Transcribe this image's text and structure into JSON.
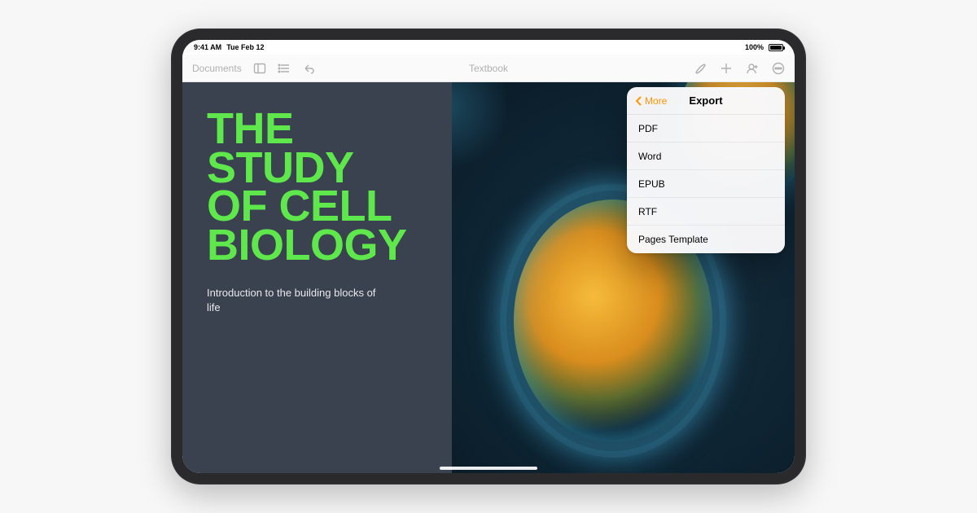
{
  "status": {
    "time": "9:41 AM",
    "date": "Tue Feb 12",
    "battery_pct": "100%"
  },
  "toolbar": {
    "back_label": "Documents",
    "doc_title": "Textbook"
  },
  "document": {
    "title_line1": "THE",
    "title_line2": "STUDY",
    "title_line3": "OF CELL",
    "title_line4": "BIOLOGY",
    "subtitle": "Introduction to the building blocks of life"
  },
  "popover": {
    "back_label": "More",
    "title": "Export",
    "items": [
      "PDF",
      "Word",
      "EPUB",
      "RTF",
      "Pages Template"
    ]
  },
  "colors": {
    "title_green": "#5FE84C",
    "left_pane_bg": "#3a4250",
    "accent_orange": "#ff9500"
  }
}
